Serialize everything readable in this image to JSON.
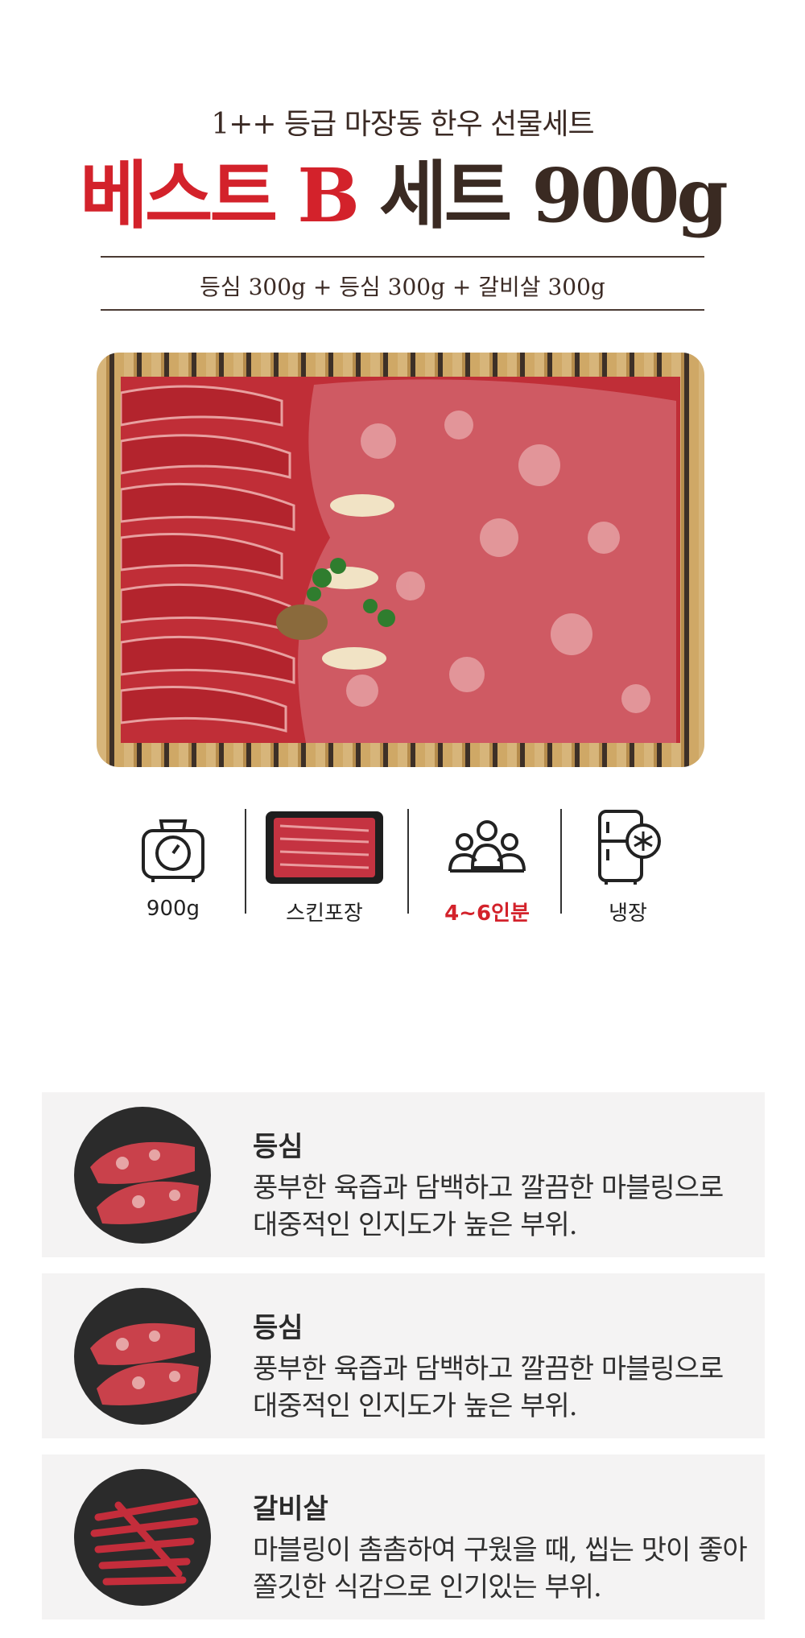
{
  "header": {
    "subtitle": "1++ 등급 마장동 한우 선물세트",
    "title_red": "베스트 B",
    "title_brown": "세트 900g",
    "composition": "등심 300g + 등심 300g + 갈비살 300g"
  },
  "features": [
    {
      "label": "900g",
      "icon": "scale-icon"
    },
    {
      "label": "스킨포장",
      "icon": "skin-pack-image"
    },
    {
      "label": "4~6인분",
      "icon": "people-icon",
      "color": "#d3222b"
    },
    {
      "label": "냉장",
      "icon": "refrigerator-icon"
    }
  ],
  "cuts": [
    {
      "name": "등심",
      "desc1": "풍부한 육즙과 담백하고 깔끔한 마블링으로",
      "desc2": "대중적인 인지도가 높은 부위."
    },
    {
      "name": "등심",
      "desc1": "풍부한 육즙과 담백하고 깔끔한 마블링으로",
      "desc2": "대중적인 인지도가 높은 부위."
    },
    {
      "name": "갈비살",
      "desc1": "마블링이 촘촘하여 구웠을 때, 씹는 맛이 좋아",
      "desc2": "쫄깃한 식감으로 인기있는 부위."
    }
  ],
  "colors": {
    "accent_red": "#d3222b",
    "brown": "#3a2a22",
    "card_bg": "#f4f3f3"
  }
}
